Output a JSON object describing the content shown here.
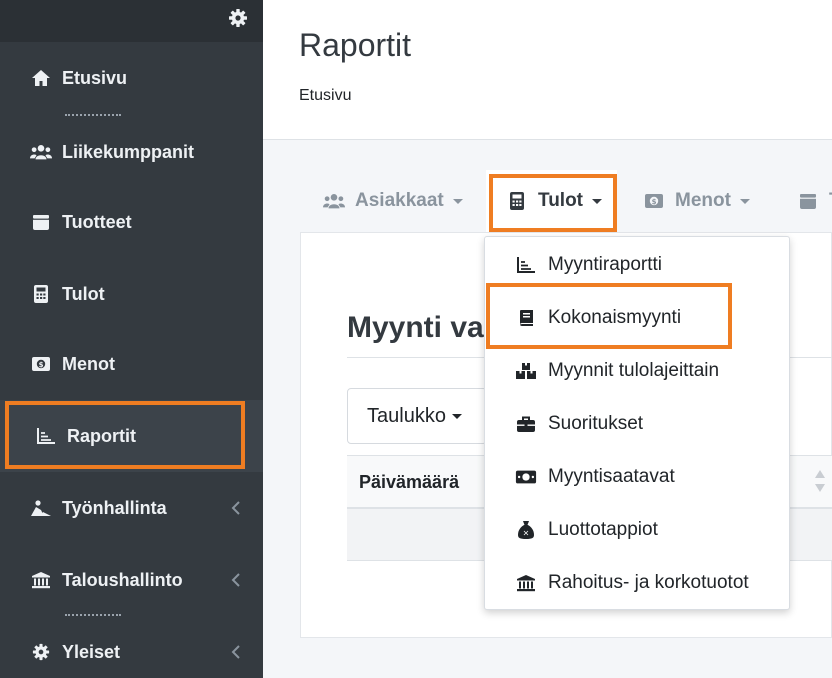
{
  "sidebar": {
    "items": [
      {
        "label": "Etusivu",
        "icon": "home-icon"
      },
      {
        "label": "Liikekumppanit",
        "icon": "users-icon"
      },
      {
        "label": "Tuotteet",
        "icon": "box-icon"
      },
      {
        "label": "Tulot",
        "icon": "calculator-icon"
      },
      {
        "label": "Menot",
        "icon": "money-icon"
      },
      {
        "label": "Raportit",
        "icon": "chart-icon",
        "active": true
      },
      {
        "label": "Työnhallinta",
        "icon": "worker-icon",
        "expandable": true
      },
      {
        "label": "Taloushallinto",
        "icon": "bank-icon",
        "expandable": true
      },
      {
        "label": "Yleiset",
        "icon": "gear-icon",
        "expandable": true
      }
    ]
  },
  "header": {
    "title": "Raportit",
    "breadcrumb": "Etusivu"
  },
  "tabs": [
    {
      "label": "Asiakkaat",
      "icon": "users-icon"
    },
    {
      "label": "Tulot",
      "icon": "calculator-icon",
      "active": true
    },
    {
      "label": "Menot",
      "icon": "money-icon"
    },
    {
      "label": "T",
      "icon": "box-icon"
    }
  ],
  "card": {
    "title": "Myynti val",
    "view_button": "Taulukko",
    "table": {
      "columns": [
        "Päivämäärä"
      ]
    }
  },
  "dropdown": {
    "items": [
      {
        "label": "Myyntiraportti",
        "icon": "chart-icon"
      },
      {
        "label": "Kokonaismyynti",
        "icon": "book-icon",
        "highlighted": true
      },
      {
        "label": "Myynnit tulolajeittain",
        "icon": "boxes-icon"
      },
      {
        "label": "Suoritukset",
        "icon": "briefcase-icon"
      },
      {
        "label": "Myyntisaatavat",
        "icon": "money-bill-icon"
      },
      {
        "label": "Luottotappiot",
        "icon": "money-bag-icon"
      },
      {
        "label": "Rahoitus- ja korkotuotot",
        "icon": "bank-icon"
      }
    ]
  },
  "colors": {
    "sidebar_bg": "#343a40",
    "highlight": "#ef7d22",
    "content_bg": "#f4f6f9"
  }
}
